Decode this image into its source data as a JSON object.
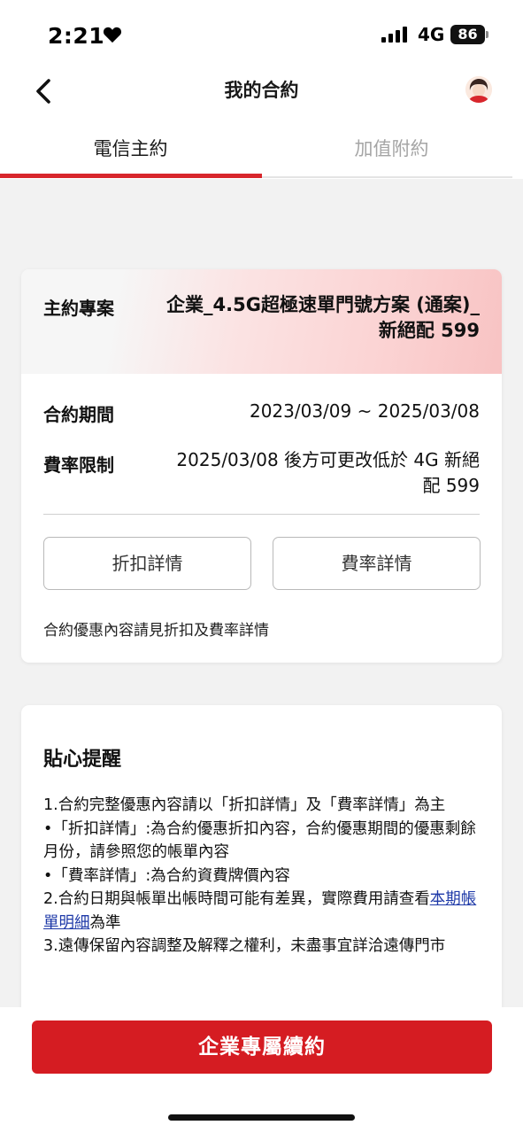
{
  "status_bar": {
    "time": "2:21",
    "network": "4G",
    "battery": "86"
  },
  "nav": {
    "title": "我的合約"
  },
  "tabs": [
    {
      "label": "電信主約",
      "active": true
    },
    {
      "label": "加值附約",
      "active": false
    }
  ],
  "contract": {
    "plan_label": "主約專案",
    "plan_value": "企業_4.5G超極速單門號方案 (通案)_新絕配 599",
    "period_label": "合約期間",
    "period_value": "2023/03/09 ~ 2025/03/08",
    "rate_label": "費率限制",
    "rate_value": "2025/03/08 後方可更改低於 4G 新絕配 599",
    "discount_button": "折扣詳情",
    "rate_button": "費率詳情",
    "note": "合約優惠內容請見折扣及費率詳情"
  },
  "reminder": {
    "title": "貼心提醒",
    "line1": "1.合約完整優惠內容請以「折扣詳情」及「費率詳情」為主",
    "line2": "•「折扣詳情」:為合約優惠折扣內容，合約優惠期間的優惠剩餘月份，請參照您的帳單內容",
    "line3": "•「費率詳情」:為合約資費牌價內容",
    "line4_prefix": "2.合約日期與帳單出帳時間可能有差異，實際費用請查看",
    "line4_link": "本期帳單明細",
    "line4_suffix": "為準",
    "line5": "3.遠傳保留內容調整及解釋之權利，未盡事宜詳洽遠傳門市"
  },
  "cta": {
    "label": "企業專屬續約"
  },
  "colors": {
    "accent": "#d51c22",
    "link": "#1f3aa8"
  },
  "icons": {
    "back": "chevron-left-icon",
    "heart": "heart-icon",
    "signal": "signal-icon",
    "battery": "battery-icon",
    "avatar": "avatar"
  }
}
